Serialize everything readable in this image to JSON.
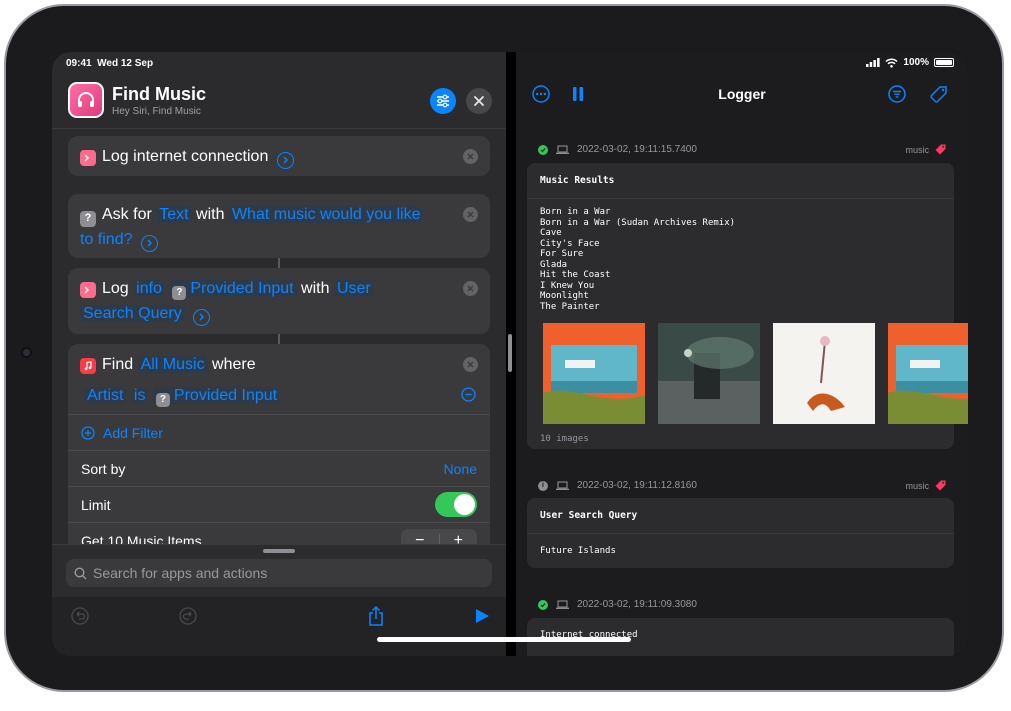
{
  "status_bar": {
    "time": "09:41",
    "date": "Wed 12 Sep",
    "battery": "100%"
  },
  "shortcut": {
    "title": "Find Music",
    "subtitle": "Hey Siri, Find Music",
    "actions": {
      "log_connection": {
        "label": "Log internet connection"
      },
      "ask": {
        "verb": "Ask for",
        "type": "Text",
        "with": "with",
        "prompt_a": "What music would you like",
        "prompt_b": "to find?"
      },
      "log": {
        "verb": "Log",
        "level": "info",
        "input": "Provided Input",
        "with": "with",
        "name_a": "User",
        "name_b": "Search Query"
      },
      "find": {
        "verb": "Find",
        "source": "All Music",
        "where": "where",
        "filter_field": "Artist",
        "filter_op": "is",
        "filter_value": "Provided Input",
        "add_filter": "Add Filter",
        "sort_label": "Sort by",
        "sort_value": "None",
        "limit_label": "Limit",
        "get_label": "Get 10 Music Items"
      }
    },
    "search_placeholder": "Search for apps and actions"
  },
  "logger": {
    "title": "Logger",
    "entries": [
      {
        "timestamp": "2022-03-02, 19:11:15.7400",
        "tag": "music",
        "title": "Music Results",
        "items": [
          "Born in a War",
          "Born in a War (Sudan Archives Remix)",
          "Cave",
          "City's Face",
          "For Sure",
          "Glada",
          "Hit the Coast",
          "I Knew You",
          "Moonlight",
          "The Painter"
        ],
        "images_label": "10 images"
      },
      {
        "timestamp": "2022-03-02, 19:11:12.8160",
        "tag": "music",
        "title": "User Search Query",
        "value": "Future Islands"
      },
      {
        "timestamp": "2022-03-02, 19:11:09.3080",
        "value": "Internet connected"
      }
    ]
  },
  "colors": {
    "accent": "#0a84ff",
    "success": "#34c759",
    "tag": "#ff375f"
  }
}
